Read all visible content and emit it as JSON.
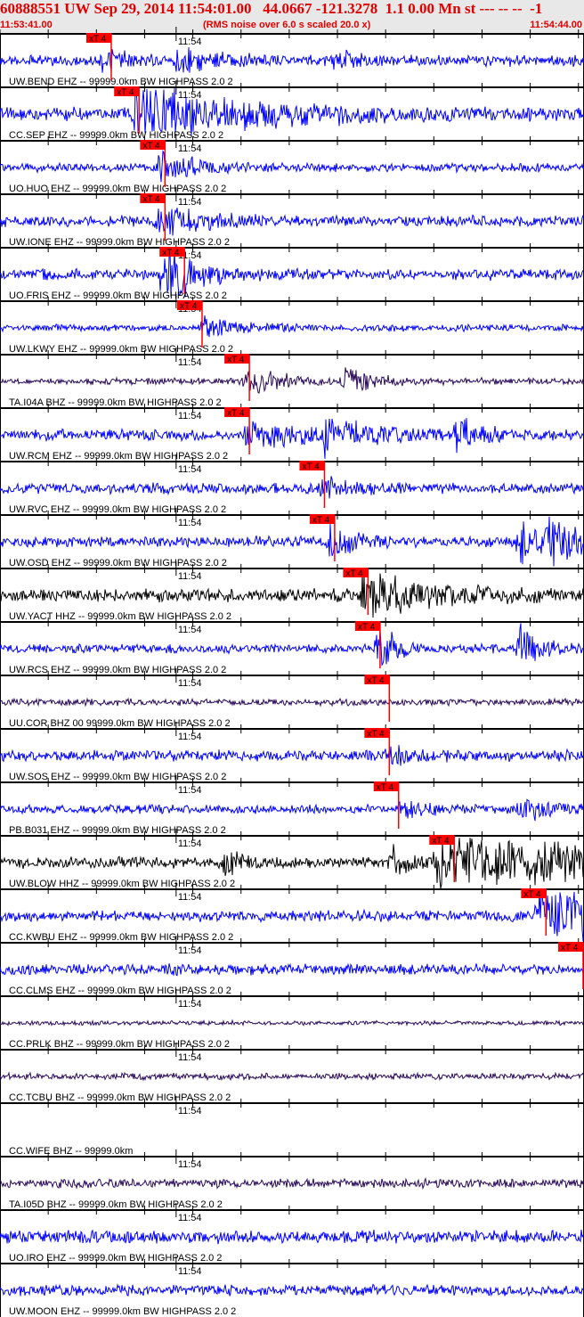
{
  "header": {
    "title": "60888551 UW Sep 29, 2014 11:54:01.00   44.0667 -121.3278  1.1 0.00 Mn st --- -- --  -1",
    "start_time": "11:53:41.00",
    "end_time": "11:54:44.00",
    "note": "(RMS noise over 6.0 s scaled 20.0 x)"
  },
  "chart_data": {
    "type": "line",
    "title": "Seismogram record section",
    "x_range_seconds": [
      0,
      63
    ],
    "x_start": "11:53:41.00",
    "minute_tick_label": "11:54",
    "minute_tick_seconds": 19,
    "pick_label": "xT 4",
    "colors": {
      "blue": "#0000ff",
      "purple": "#2a0a5a",
      "black": "#000000",
      "pick": "#ff0000"
    },
    "traces": [
      {
        "label": "UW.BEND EHZ -- 99999.0km BW  HIGHPASS  2.0  2",
        "color": "#0000ff",
        "noise": 5,
        "pick": 12.0,
        "events": [
          [
            11,
            10,
            3
          ],
          [
            19,
            12,
            4
          ],
          [
            36,
            10,
            2
          ]
        ]
      },
      {
        "label": "CC.SEP EHZ -- 99999.0km BW  HIGHPASS  2.0  2",
        "color": "#0000ff",
        "noise": 6,
        "pick": 15.0,
        "events": [
          [
            14.5,
            26,
            12
          ]
        ]
      },
      {
        "label": "UO.HUO EHZ -- 99999.0km BW  HIGHPASS  2.0  2",
        "color": "#0000ff",
        "noise": 4,
        "pick": 17.8,
        "events": [
          [
            17,
            15,
            4
          ]
        ]
      },
      {
        "label": "UW.IONE EHZ -- 99999.0km BW  HIGHPASS  2.0  2",
        "color": "#0000ff",
        "noise": 5,
        "pick": 17.8,
        "events": [
          [
            17,
            14,
            5
          ]
        ]
      },
      {
        "label": "UO.FRIS EHZ -- 99999.0km BW  HIGHPASS  2.0  2",
        "color": "#0000ff",
        "noise": 5,
        "pick": 19.9,
        "events": [
          [
            17.5,
            30,
            3
          ]
        ]
      },
      {
        "label": "UW.LKWY EHZ -- 99999.0km BW  HIGHPASS  2.0  2",
        "color": "#0000ff",
        "noise": 3,
        "pick": 21.8,
        "events": [
          [
            22,
            10,
            4
          ]
        ]
      },
      {
        "label": "TA.I04A BHZ -- 99999.0km BW  HIGHPASS  2.0  2",
        "color": "#2a0a5a",
        "noise": 3,
        "pick": 26.9,
        "events": [
          [
            26.5,
            12,
            4
          ],
          [
            37,
            12,
            3
          ]
        ]
      },
      {
        "label": "UW.RCM EHZ -- 99999.0km BW  HIGHPASS  2.0  2",
        "color": "#0000ff",
        "noise": 5,
        "pick": 26.9,
        "events": [
          [
            26.5,
            18,
            4
          ],
          [
            35,
            18,
            5
          ],
          [
            49,
            25,
            2
          ]
        ]
      },
      {
        "label": "UW.RVC EHZ -- 99999.0km BW  HIGHPASS  2.0  2",
        "color": "#0000ff",
        "noise": 5,
        "pick": 35.0,
        "events": [
          [
            34.8,
            15,
            2
          ]
        ]
      },
      {
        "label": "UW.OSD EHZ -- 99999.0km BW  HIGHPASS  2.0  2",
        "color": "#0000ff",
        "noise": 5,
        "pick": 36.1,
        "events": [
          [
            35.5,
            15,
            3
          ],
          [
            56,
            20,
            2
          ],
          [
            59,
            25,
            3
          ]
        ]
      },
      {
        "label": "UW.YACT HHZ -- 99999.0km BW  HIGHPASS  2.0  2",
        "color": "#000000",
        "noise": 6,
        "pick": 39.7,
        "events": [
          [
            39,
            22,
            7
          ]
        ]
      },
      {
        "label": "UW.RCS EHZ -- 99999.0km BW  HIGHPASS  2.0  2",
        "color": "#0000ff",
        "noise": 4,
        "pick": 41.0,
        "events": [
          [
            40.5,
            28,
            2
          ],
          [
            56,
            25,
            2
          ]
        ]
      },
      {
        "label": "UU.COR BHZ 00 99999.0km BW  HIGHPASS  2.0  2",
        "color": "#2a0a5a",
        "noise": 3,
        "pick": 42.0,
        "events": []
      },
      {
        "label": "UW.SOS EHZ -- 99999.0km BW  HIGHPASS  2.0  2",
        "color": "#0000ff",
        "noise": 5,
        "pick": 42.0,
        "events": [
          [
            41.5,
            10,
            3
          ]
        ]
      },
      {
        "label": "PB.B031 EHZ -- 99999.0km BW  HIGHPASS  2.0  2",
        "color": "#0000ff",
        "noise": 4,
        "pick": 43.0,
        "events": [
          [
            43,
            8,
            3
          ],
          [
            56,
            9,
            4
          ]
        ]
      },
      {
        "label": "UW.BLOW HHZ -- 99999.0km BW  HIGHPASS  2.0  2",
        "color": "#000000",
        "noise": 5,
        "pick": 49.0,
        "events": [
          [
            24,
            12,
            2
          ],
          [
            42,
            15,
            2
          ],
          [
            47,
            30,
            18
          ]
        ]
      },
      {
        "label": "CC.KWBU EHZ -- 99999.0km BW  HIGHPASS  2.0  2",
        "color": "#0000ff",
        "noise": 5,
        "pick": 58.9,
        "events": [
          [
            58,
            30,
            8
          ]
        ]
      },
      {
        "label": "CC.CLMS EHZ -- 99999.0km BW  HIGHPASS  2.0  2",
        "color": "#0000ff",
        "noise": 5,
        "pick": 63.0,
        "events": []
      },
      {
        "label": "CC.PRLK BHZ -- 99999.0km BW  HIGHPASS  2.0  2",
        "color": "#2a0a5a",
        "noise": 2,
        "pick": null,
        "events": []
      },
      {
        "label": "CC.TCBU BHZ -- 99999.0km BW  HIGHPASS  2.0  2",
        "color": "#2a0a5a",
        "noise": 3,
        "pick": null,
        "events": []
      },
      {
        "label": "CC.WIFE BHZ -- 99999.0km",
        "color": "#2a0a5a",
        "noise": 0,
        "pick": null,
        "events": []
      },
      {
        "label": "TA.I05D BHZ -- 99999.0km BW  HIGHPASS  2.0  2",
        "color": "#2a0a5a",
        "noise": 4,
        "pick": null,
        "events": []
      },
      {
        "label": "UO.IRO EHZ -- 99999.0km BW  HIGHPASS  2.0  2",
        "color": "#0000ff",
        "noise": 6,
        "pick": null,
        "events": []
      },
      {
        "label": "UW.MOON EHZ -- 99999.0km BW  HIGHPASS  2.0  2",
        "color": "#0000ff",
        "noise": 5,
        "pick": null,
        "events": []
      }
    ]
  }
}
